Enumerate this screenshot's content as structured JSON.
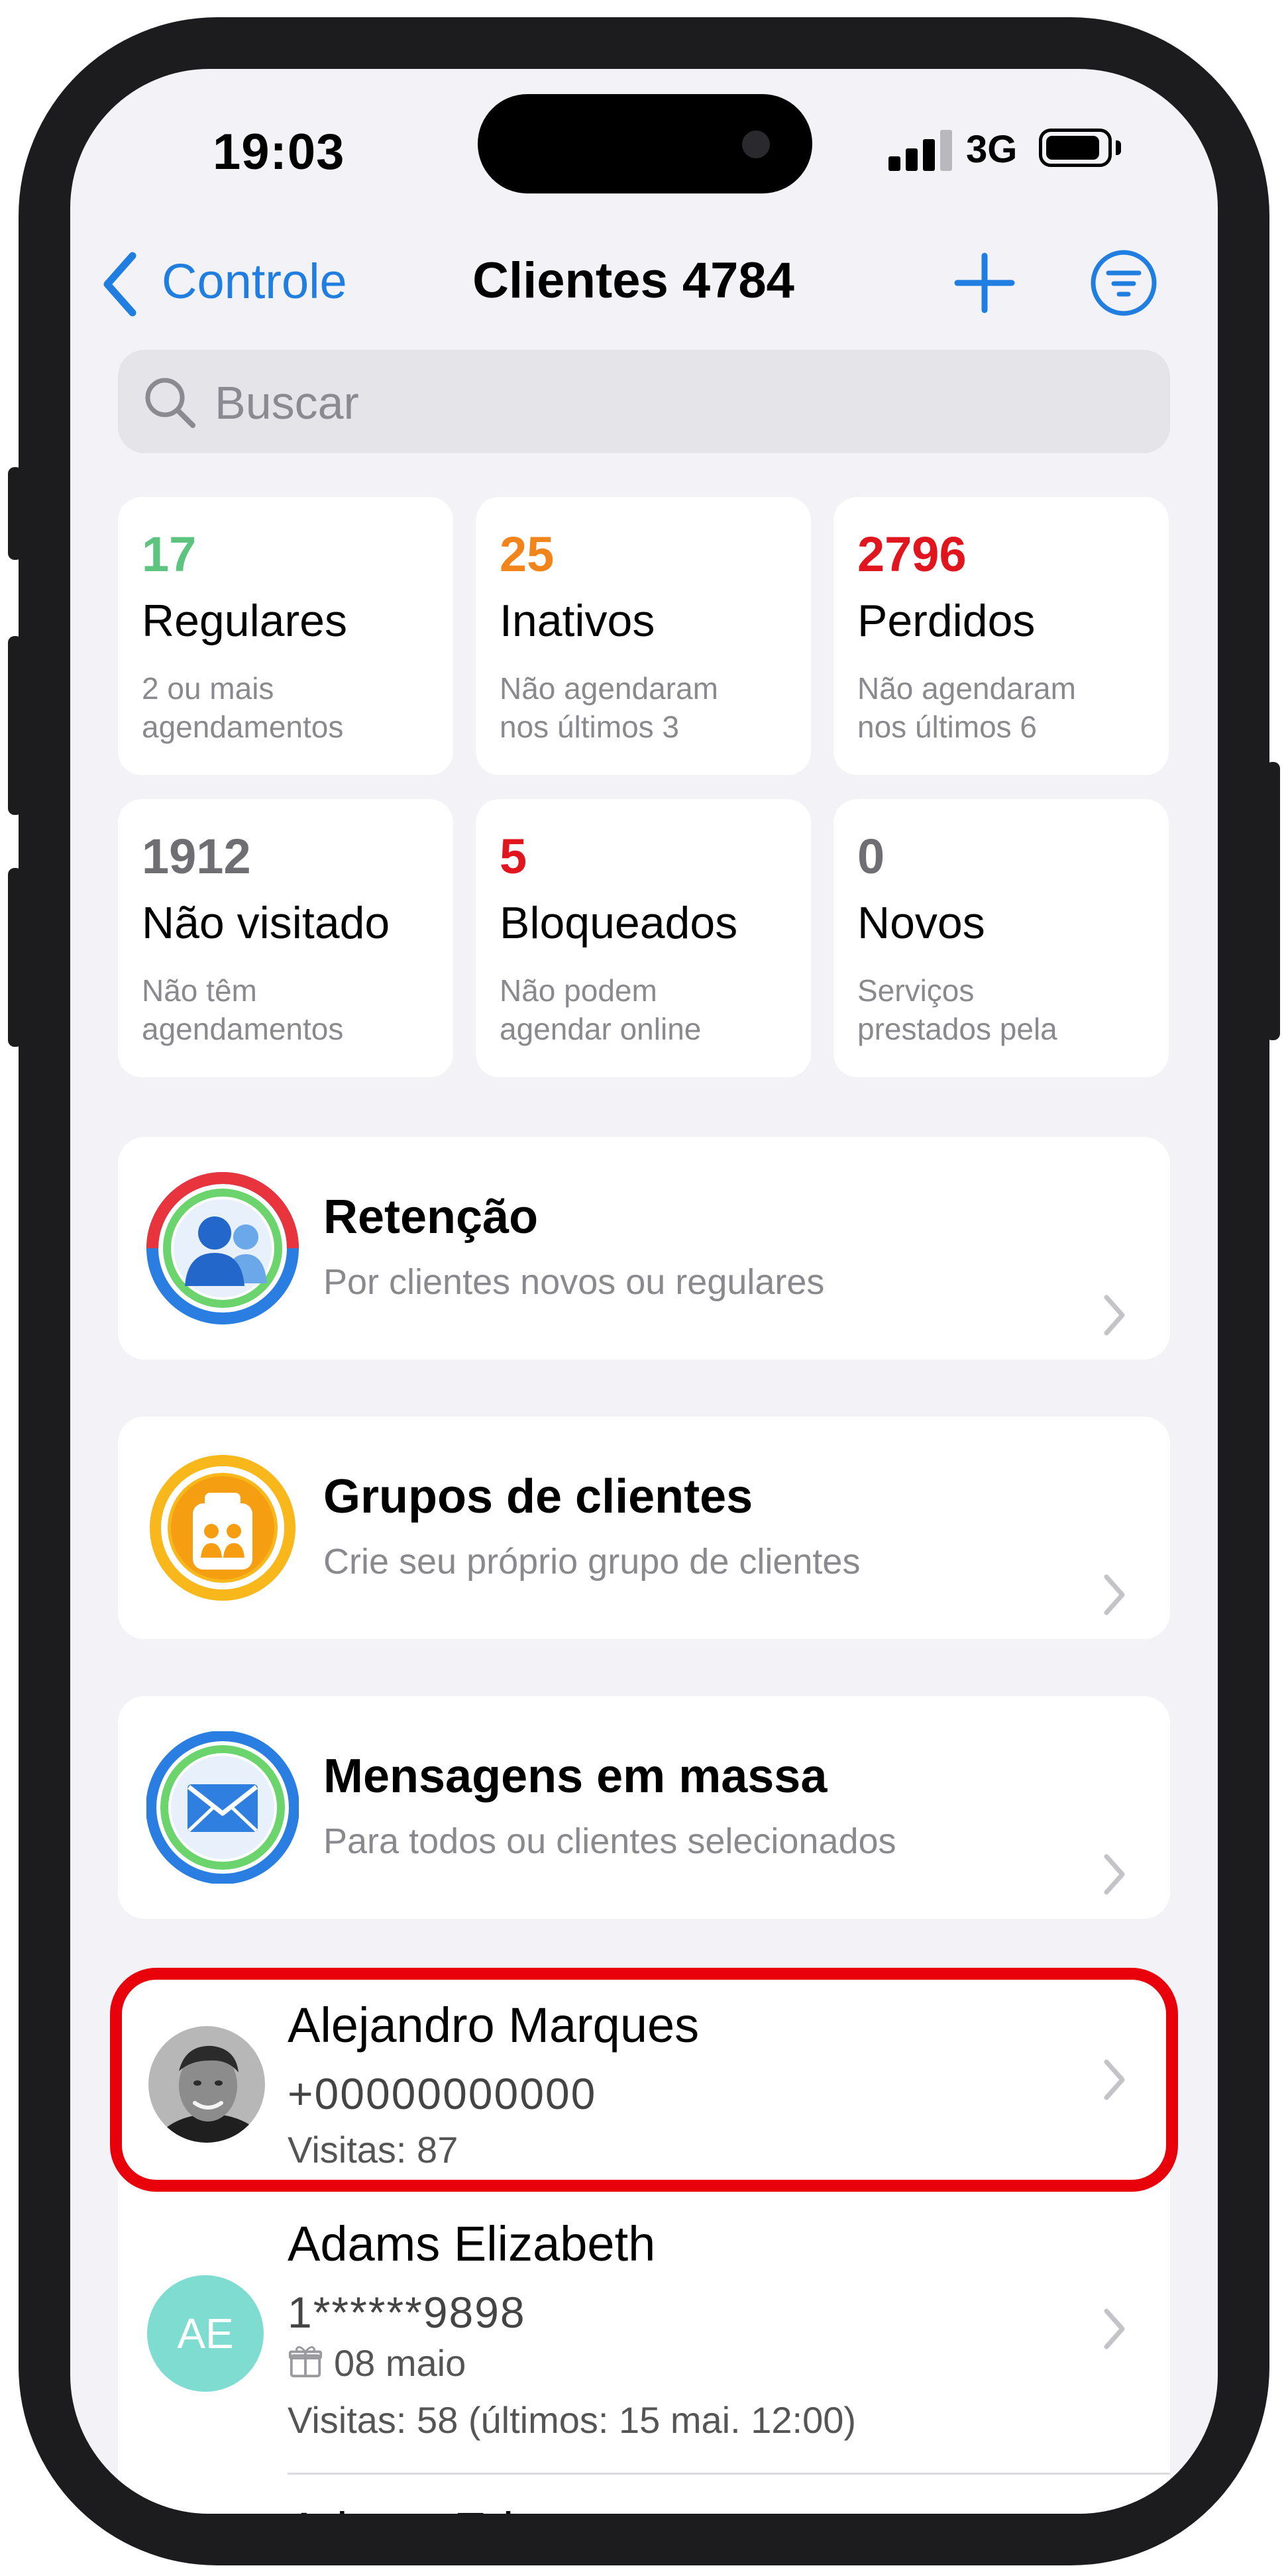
{
  "status_bar": {
    "time": "19:03",
    "network": "3G"
  },
  "nav": {
    "back_label": "Controle",
    "title": "Clientes 4784"
  },
  "search": {
    "placeholder": "Buscar"
  },
  "stats": [
    {
      "count": "17",
      "color": "#5cc47e",
      "title": "Regulares",
      "desc_line1": "2 ou mais",
      "desc_line2": "agendamentos"
    },
    {
      "count": "25",
      "color": "#f2841c",
      "title": "Inativos",
      "desc_line1": "Não agendaram",
      "desc_line2": "nos últimos 3"
    },
    {
      "count": "2796",
      "color": "#e0151e",
      "title": "Perdidos",
      "desc_line1": "Não agendaram",
      "desc_line2": "nos últimos 6"
    },
    {
      "count": "1912",
      "color": "#6e6e73",
      "title": "Não visitado",
      "desc_line1": "Não têm",
      "desc_line2": "agendamentos"
    },
    {
      "count": "5",
      "color": "#e0151e",
      "title": "Bloqueados",
      "desc_line1": "Não podem",
      "desc_line2": "agendar online"
    },
    {
      "count": "0",
      "color": "#6e6e73",
      "title": "Novos",
      "desc_line1": "Serviços",
      "desc_line2": "prestados pela"
    }
  ],
  "actions": [
    {
      "title": "Retenção",
      "subtitle": "Por clientes novos ou regulares",
      "icon": "retention-users-icon"
    },
    {
      "title": "Grupos de clientes",
      "subtitle": "Crie seu próprio grupo de clientes",
      "icon": "client-groups-icon"
    },
    {
      "title": "Mensagens em massa",
      "subtitle": "Para todos ou clientes selecionados",
      "icon": "mass-message-envelope-icon"
    }
  ],
  "clients": [
    {
      "name": "Alejandro Marques",
      "phone": "+00000000000",
      "visits": "Visitas: 87"
    },
    {
      "name": "Adams Elizabeth",
      "initials": "AE",
      "phone": "1******9898",
      "birthday": "08 maio",
      "visits": "Visitas: 58 (últimos: 15 mai.  12:00)"
    },
    {
      "name": "Adams Erin"
    }
  ],
  "colors": {
    "accent": "#1f7ee0",
    "highlight": "#e8000b",
    "avatar_teal": "#7fdcd1"
  }
}
